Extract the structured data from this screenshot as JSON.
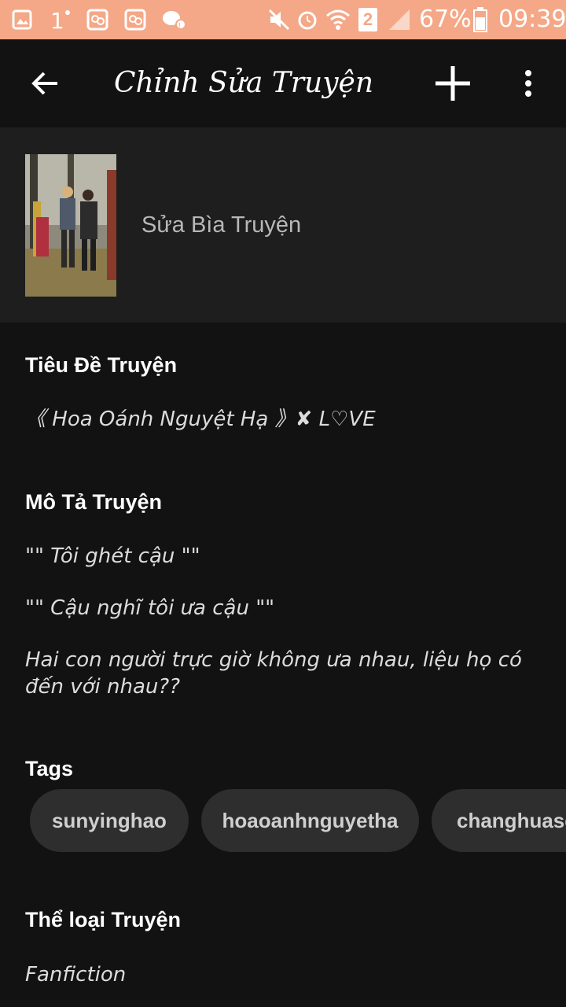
{
  "colors": {
    "status_bar_bg": "#f4a887",
    "background": "#121212",
    "cover_section_bg": "#1e1e1e",
    "tag_bg": "#2e2e2e"
  },
  "status_bar": {
    "sim_number": "2",
    "battery": "67%",
    "time": "09:39",
    "icons": [
      "gallery-icon",
      "notification-1-icon",
      "chat-icon",
      "chat-icon",
      "messenger-icon",
      "mute-icon",
      "alarm-icon",
      "wifi-icon",
      "sim-2-icon",
      "signal-icon",
      "battery-icon"
    ]
  },
  "app_bar": {
    "title": "Chỉnh Sửa Truyện",
    "icons": [
      "back-arrow-icon",
      "plus-icon",
      "more-vertical-icon"
    ]
  },
  "cover": {
    "label": "Sửa Bìa Truyện"
  },
  "story_title": {
    "heading": "Tiêu Đề Truyện",
    "value": "《 Hoa Oánh Nguyệt Hạ 》✘ L♡VE"
  },
  "description": {
    "heading": "Mô Tả Truyện",
    "lines": [
      "\"\" Tôi ghét cậu \"\"",
      "\"\" Cậu nghĩ tôi ưa cậu \"\"",
      "Hai con người trực giờ không ưa nhau, liệu họ có đến với nhau??"
    ]
  },
  "tags": {
    "heading": "Tags",
    "items": [
      "sunyinghao",
      "hoaoanhnguyetha",
      "changhuase"
    ]
  },
  "genre": {
    "heading": "Thể loại Truyện",
    "value": "Fanfiction"
  }
}
